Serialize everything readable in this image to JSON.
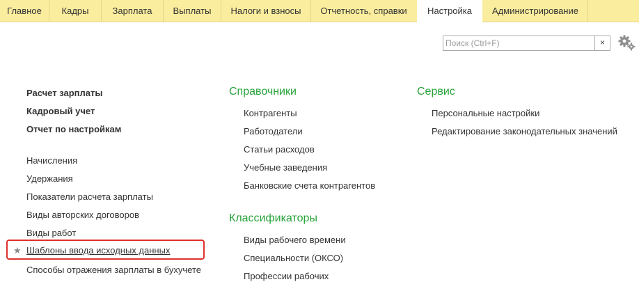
{
  "menu": {
    "items": [
      {
        "label": "Главное"
      },
      {
        "label": "Кадры"
      },
      {
        "label": "Зарплата"
      },
      {
        "label": "Выплаты"
      },
      {
        "label": "Налоги и взносы"
      },
      {
        "label": "Отчетность, справки"
      },
      {
        "label": "Настройка",
        "active": true
      },
      {
        "label": "Администрирование"
      }
    ]
  },
  "search": {
    "placeholder": "Поиск (Ctrl+F)",
    "value": "",
    "clear_label": "×"
  },
  "colors": {
    "menu_bg": "#fbed9e",
    "section_title": "#28a339",
    "highlight": "#e0302c"
  },
  "left": {
    "bold_links": [
      "Расчет зарплаты",
      "Кадровый учет",
      "Отчет по настройкам"
    ],
    "links": [
      "Начисления",
      "Удержания",
      "Показатели расчета зарплаты",
      "Виды авторских договоров",
      "Виды работ",
      "Шаблоны ввода исходных данных",
      "Способы отражения зарплаты в бухучете"
    ],
    "star": "★"
  },
  "middle": {
    "sections": [
      {
        "title": "Справочники",
        "items": [
          "Контрагенты",
          "Работодатели",
          "Статьи расходов",
          "Учебные заведения",
          "Банковские счета контрагентов"
        ]
      },
      {
        "title": "Классификаторы",
        "items": [
          "Виды рабочего времени",
          "Специальности (ОКСО)",
          "Профессии рабочих"
        ]
      }
    ]
  },
  "right": {
    "title": "Сервис",
    "items": [
      "Персональные настройки",
      "Редактирование законодательных значений"
    ]
  }
}
